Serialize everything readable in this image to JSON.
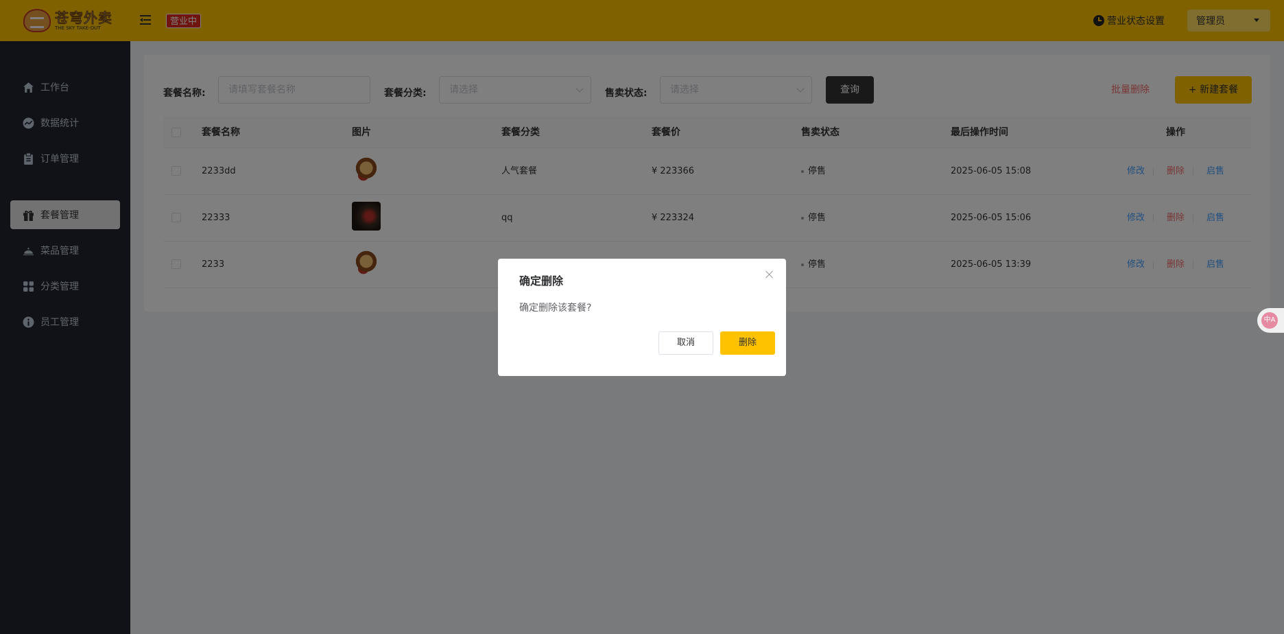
{
  "header": {
    "logo_cn": "苍穹外卖",
    "logo_en": "THE SKY TAKE-OUT",
    "shop_status": "营业中",
    "business_setting": "营业状态设置",
    "user": "管理员"
  },
  "sidebar": {
    "items": [
      {
        "label": "工作台",
        "icon": "home-icon"
      },
      {
        "label": "数据统计",
        "icon": "chart-icon"
      },
      {
        "label": "订单管理",
        "icon": "clipboard-icon"
      },
      {
        "label": "套餐管理",
        "icon": "gift-icon",
        "active": true
      },
      {
        "label": "菜品管理",
        "icon": "dish-icon"
      },
      {
        "label": "分类管理",
        "icon": "grid-icon"
      },
      {
        "label": "员工管理",
        "icon": "info-icon"
      }
    ]
  },
  "filters": {
    "name_label": "套餐名称:",
    "name_placeholder": "请填写套餐名称",
    "category_label": "套餐分类:",
    "category_placeholder": "请选择",
    "status_label": "售卖状态:",
    "status_placeholder": "请选择",
    "query_button": "查询",
    "batch_delete": "批量删除",
    "new_button": "+ 新建套餐"
  },
  "table": {
    "headers": [
      "套餐名称",
      "图片",
      "套餐分类",
      "套餐价",
      "售卖状态",
      "最后操作时间",
      "操作"
    ],
    "rows": [
      {
        "name": "2233dd",
        "category": "人气套餐",
        "price": "¥ 223366",
        "status": "停售",
        "time": "2025-06-05 15:08"
      },
      {
        "name": "22333",
        "category": "qq",
        "price": "¥ 223324",
        "status": "停售",
        "time": "2025-06-05 15:06"
      },
      {
        "name": "2233",
        "category": "",
        "price": "",
        "status": "停售",
        "time": "2025-06-05 13:39"
      }
    ],
    "actions": {
      "edit": "修改",
      "delete": "删除",
      "enable": "启售"
    }
  },
  "dialog": {
    "title": "确定删除",
    "message": "确定删除该套餐?",
    "cancel": "取消",
    "confirm": "删除"
  },
  "translate_widget": "中A",
  "colors": {
    "accent": "#ffc200",
    "sidebar": "#22252e",
    "danger": "#f56c6c",
    "link": "#419eff"
  }
}
